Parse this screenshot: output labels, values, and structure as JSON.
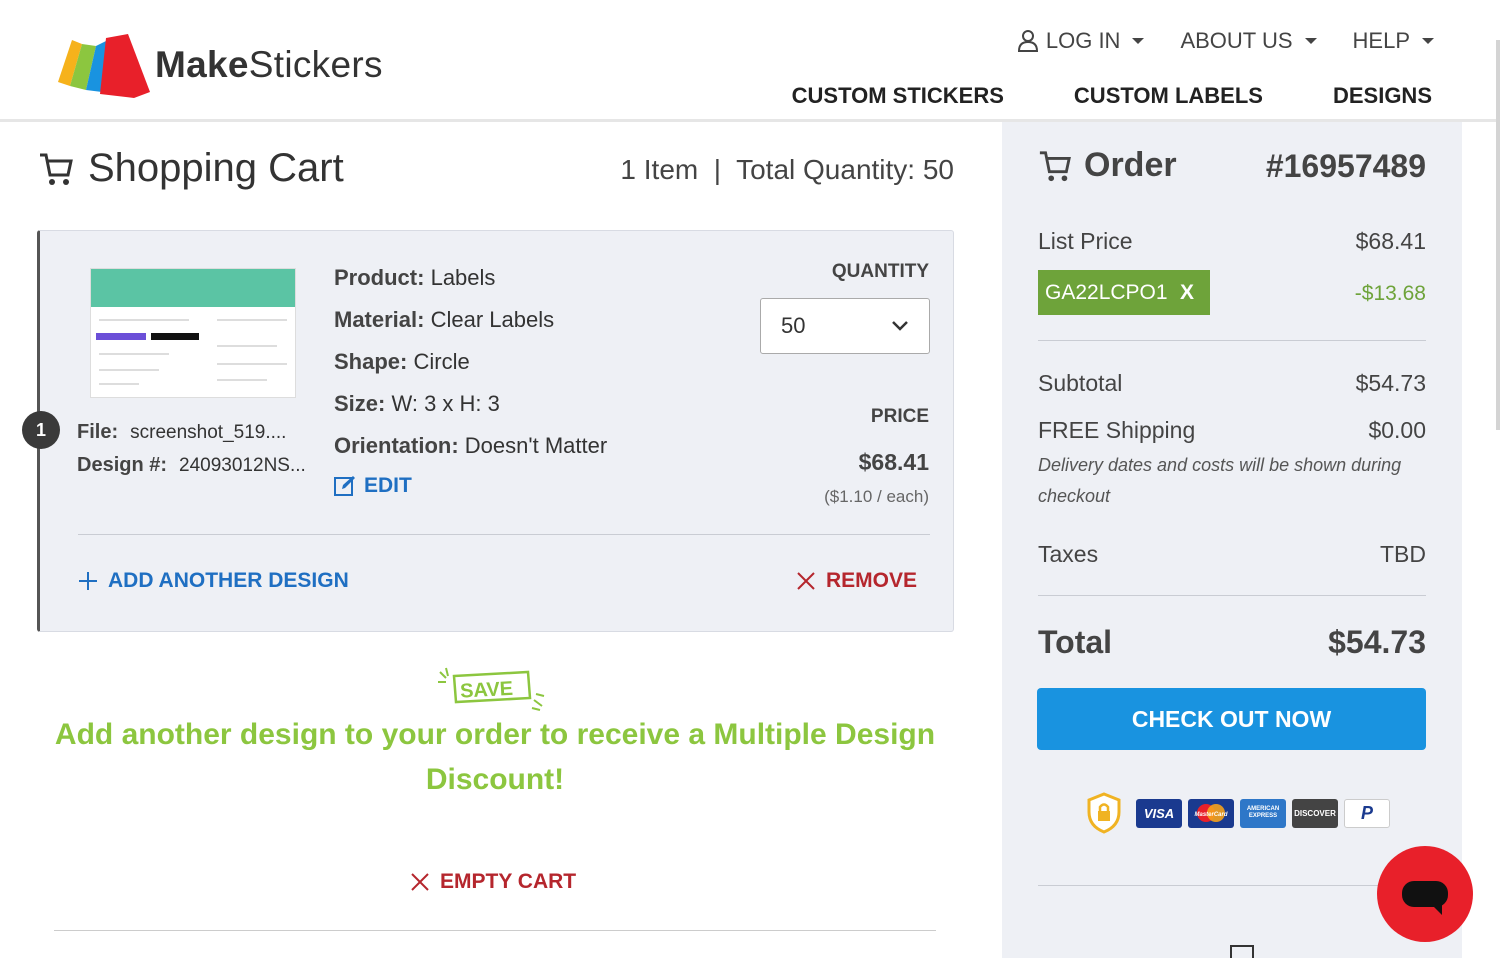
{
  "header": {
    "logo": {
      "bold": "Make",
      "light": "Stickers"
    },
    "topnav": [
      {
        "label": "LOG IN",
        "icon": "user-icon"
      },
      {
        "label": "ABOUT US"
      },
      {
        "label": "HELP"
      }
    ],
    "mainnav": [
      "CUSTOM STICKERS",
      "CUSTOM LABELS",
      "DESIGNS"
    ]
  },
  "cart": {
    "title": "Shopping Cart",
    "summary": "1 Item  |  Total Quantity: 50",
    "item": {
      "index": "1",
      "file_label": "File:",
      "file_value": "screenshot_519....",
      "design_label": "Design #:",
      "design_value": "24093012NS...",
      "specs": [
        {
          "label": "Product:",
          "value": "Labels"
        },
        {
          "label": "Material:",
          "value": "Clear Labels"
        },
        {
          "label": "Shape:",
          "value": "Circle"
        },
        {
          "label": "Size:",
          "value": "W: 3 x H: 3"
        },
        {
          "label": "Orientation:",
          "value": "Doesn't Matter"
        }
      ],
      "edit_label": "EDIT",
      "quantity_label": "QUANTITY",
      "quantity_value": "50",
      "price_label": "PRICE",
      "price_value": "$68.41",
      "price_each": "($1.10 / each)"
    },
    "add_design_label": "ADD ANOTHER DESIGN",
    "remove_label": "REMOVE",
    "save_badge": "SAVE",
    "promo_text": "Add another design to your order to receive a Multiple Design Discount!",
    "empty_cart_label": "EMPTY CART"
  },
  "order": {
    "title": "Order",
    "number": "#16957489",
    "list_price_label": "List Price",
    "list_price_value": "$68.41",
    "coupon_code": "GA22LCPO1",
    "coupon_remove": "X",
    "discount_value": "-$13.68",
    "subtotal_label": "Subtotal",
    "subtotal_value": "$54.73",
    "shipping_label": "FREE Shipping",
    "shipping_value": "$0.00",
    "delivery_note": "Delivery dates and costs will be shown during checkout",
    "taxes_label": "Taxes",
    "taxes_value": "TBD",
    "total_label": "Total",
    "total_value": "$54.73",
    "checkout_label": "CHECK OUT NOW",
    "payment_methods": [
      "VISA",
      "MasterCard",
      "AMERICAN EXPRESS",
      "DISCOVER",
      "P"
    ]
  },
  "colors": {
    "accent_blue": "#1993e0",
    "link_blue": "#1f6fc2",
    "remove_red": "#b5262d",
    "promo_green": "#8cc63f",
    "coupon_green": "#6ea33a",
    "chat_red": "#e8202a"
  }
}
